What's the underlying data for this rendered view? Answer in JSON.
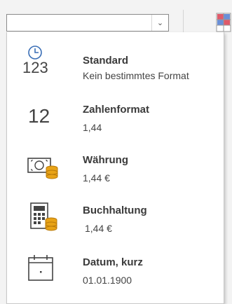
{
  "combo": {
    "value": "",
    "dropdown_glyph": "⌄"
  },
  "formats": [
    {
      "title": "Standard",
      "desc": "Kein bestimmtes Format",
      "icon": "clock-123-icon",
      "icon_text": "123"
    },
    {
      "title": "Zahlenformat",
      "desc": "1,44",
      "icon": "number-12-icon",
      "icon_text": "12"
    },
    {
      "title": "Währung",
      "desc": "1,44 €",
      "icon": "currency-coins-icon"
    },
    {
      "title": "Buchhaltung",
      "desc": "1,44 €",
      "icon": "calculator-coins-icon"
    },
    {
      "title": "Datum, kurz",
      "desc": "01.01.1900",
      "icon": "calendar-icon"
    }
  ],
  "colors": {
    "accent_blue": "#3b6fb6",
    "coin_gold": "#e8a317",
    "toolbar_bg": "#f3f3f3"
  }
}
